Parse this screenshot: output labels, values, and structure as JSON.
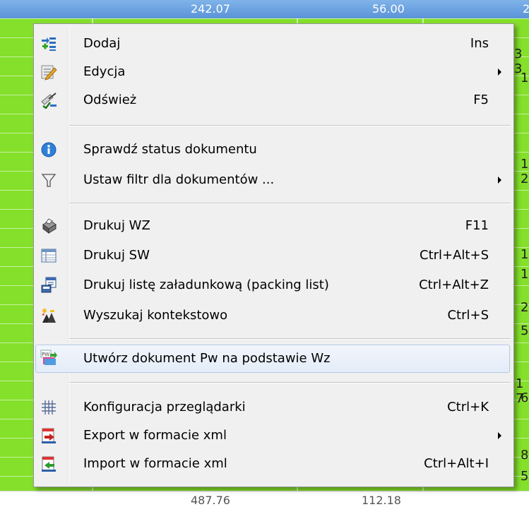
{
  "background": {
    "header_values": [
      "242.07",
      "56.00",
      "2"
    ],
    "footer_values": [
      "487.76",
      "112.18"
    ],
    "edge_digits": [
      "3 3",
      "1",
      "1",
      "2",
      "1",
      "1",
      "2",
      "5",
      "1 7",
      "6",
      "8",
      "5"
    ]
  },
  "menu": {
    "items": [
      {
        "label": "Dodaj",
        "shortcut": "Ins",
        "submenu": false,
        "icon": "add-list-icon"
      },
      {
        "label": "Edycja",
        "shortcut": "",
        "submenu": true,
        "icon": "edit-pencil-icon"
      },
      {
        "label": "Odśwież",
        "shortcut": "F5",
        "submenu": false,
        "icon": "refresh-check-icon"
      },
      {
        "label": "Sprawdź status dokumentu",
        "shortcut": "",
        "submenu": false,
        "icon": "info-icon"
      },
      {
        "label": "Ustaw filtr dla dokumentów ...",
        "shortcut": "",
        "submenu": true,
        "icon": "filter-icon"
      },
      {
        "label": "Drukuj WZ",
        "shortcut": "F11",
        "submenu": false,
        "icon": "printer-icon"
      },
      {
        "label": "Drukuj SW",
        "shortcut": "Ctrl+Alt+S",
        "submenu": false,
        "icon": "grid-document-icon"
      },
      {
        "label": "Drukuj listę załadunkową (packing list)",
        "shortcut": "Ctrl+Alt+Z",
        "submenu": false,
        "icon": "packing-list-icon"
      },
      {
        "label": "Wyszukaj kontekstowo",
        "shortcut": "Ctrl+S",
        "submenu": false,
        "icon": "context-search-icon"
      },
      {
        "label": "Utwórz dokument Pw na podstawie Wz",
        "shortcut": "",
        "submenu": false,
        "icon": "pw-document-icon",
        "highlighted": true
      },
      {
        "label": "Konfiguracja przeglądarki",
        "shortcut": "Ctrl+K",
        "submenu": false,
        "icon": "grid-config-icon"
      },
      {
        "label": "Export w formacie xml",
        "shortcut": "",
        "submenu": true,
        "icon": "export-xml-icon"
      },
      {
        "label": "Import w formacie xml",
        "shortcut": "Ctrl+Alt+I",
        "submenu": false,
        "icon": "import-xml-icon"
      }
    ]
  },
  "colors": {
    "grid_green": "#84e02a",
    "menu_bg": "#f0f0f0",
    "highlight_border": "#b3c9e5",
    "header_blue": "#5b93d8"
  }
}
